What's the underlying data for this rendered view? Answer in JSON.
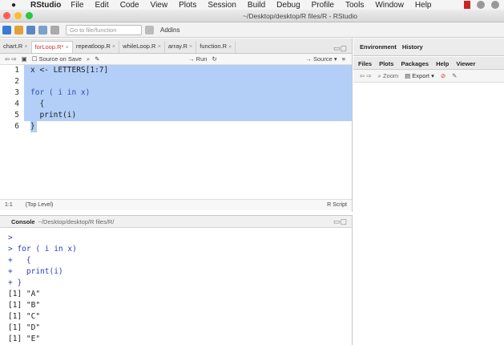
{
  "menubar": {
    "app": "RStudio",
    "items": [
      "File",
      "Edit",
      "Code",
      "View",
      "Plots",
      "Session",
      "Build",
      "Debug",
      "Profile",
      "Tools",
      "Window",
      "Help"
    ]
  },
  "window": {
    "title": "~/Desktop/desktop/R files/R - RStudio"
  },
  "toolbar": {
    "goto_placeholder": "Go to file/function",
    "addins": "Addins"
  },
  "editor": {
    "tabs": [
      {
        "label": "chart.R"
      },
      {
        "label": "forLoop.R*"
      },
      {
        "label": "repeatloop.R"
      },
      {
        "label": "whileLoop.R"
      },
      {
        "label": "array.R"
      },
      {
        "label": "function.R"
      }
    ],
    "source_on_save": "Source on Save",
    "run": "Run",
    "source": "Source",
    "lines": [
      {
        "n": "1",
        "text": "x <- LETTERS[1:7]"
      },
      {
        "n": "2",
        "text": ""
      },
      {
        "n": "3",
        "text": "for ( i in x)"
      },
      {
        "n": "4",
        "text": "  {"
      },
      {
        "n": "5",
        "text": "  print(i)"
      },
      {
        "n": "6",
        "text": "}"
      }
    ],
    "status": {
      "position": "1:1",
      "scope": "(Top Level)",
      "filetype": "R Script"
    }
  },
  "console": {
    "title": "Console",
    "path": "~/Desktop/desktop/R files/R/",
    "lines": [
      {
        "text": ">",
        "cmd": true
      },
      {
        "text": "> for ( i in x)",
        "cmd": true
      },
      {
        "text": "+   {",
        "cmd": true
      },
      {
        "text": "+   print(i)",
        "cmd": true
      },
      {
        "text": "+ }",
        "cmd": true
      },
      {
        "text": "[1] \"A\"",
        "cmd": false
      },
      {
        "text": "[1] \"B\"",
        "cmd": false
      },
      {
        "text": "[1] \"C\"",
        "cmd": false
      },
      {
        "text": "[1] \"D\"",
        "cmd": false
      },
      {
        "text": "[1] \"E\"",
        "cmd": false
      }
    ]
  },
  "env_pane": {
    "tabs": [
      "Environment",
      "History"
    ]
  },
  "files_pane": {
    "tabs": [
      "Files",
      "Plots",
      "Packages",
      "Help",
      "Viewer"
    ],
    "zoom": "Zoom",
    "export": "Export"
  }
}
